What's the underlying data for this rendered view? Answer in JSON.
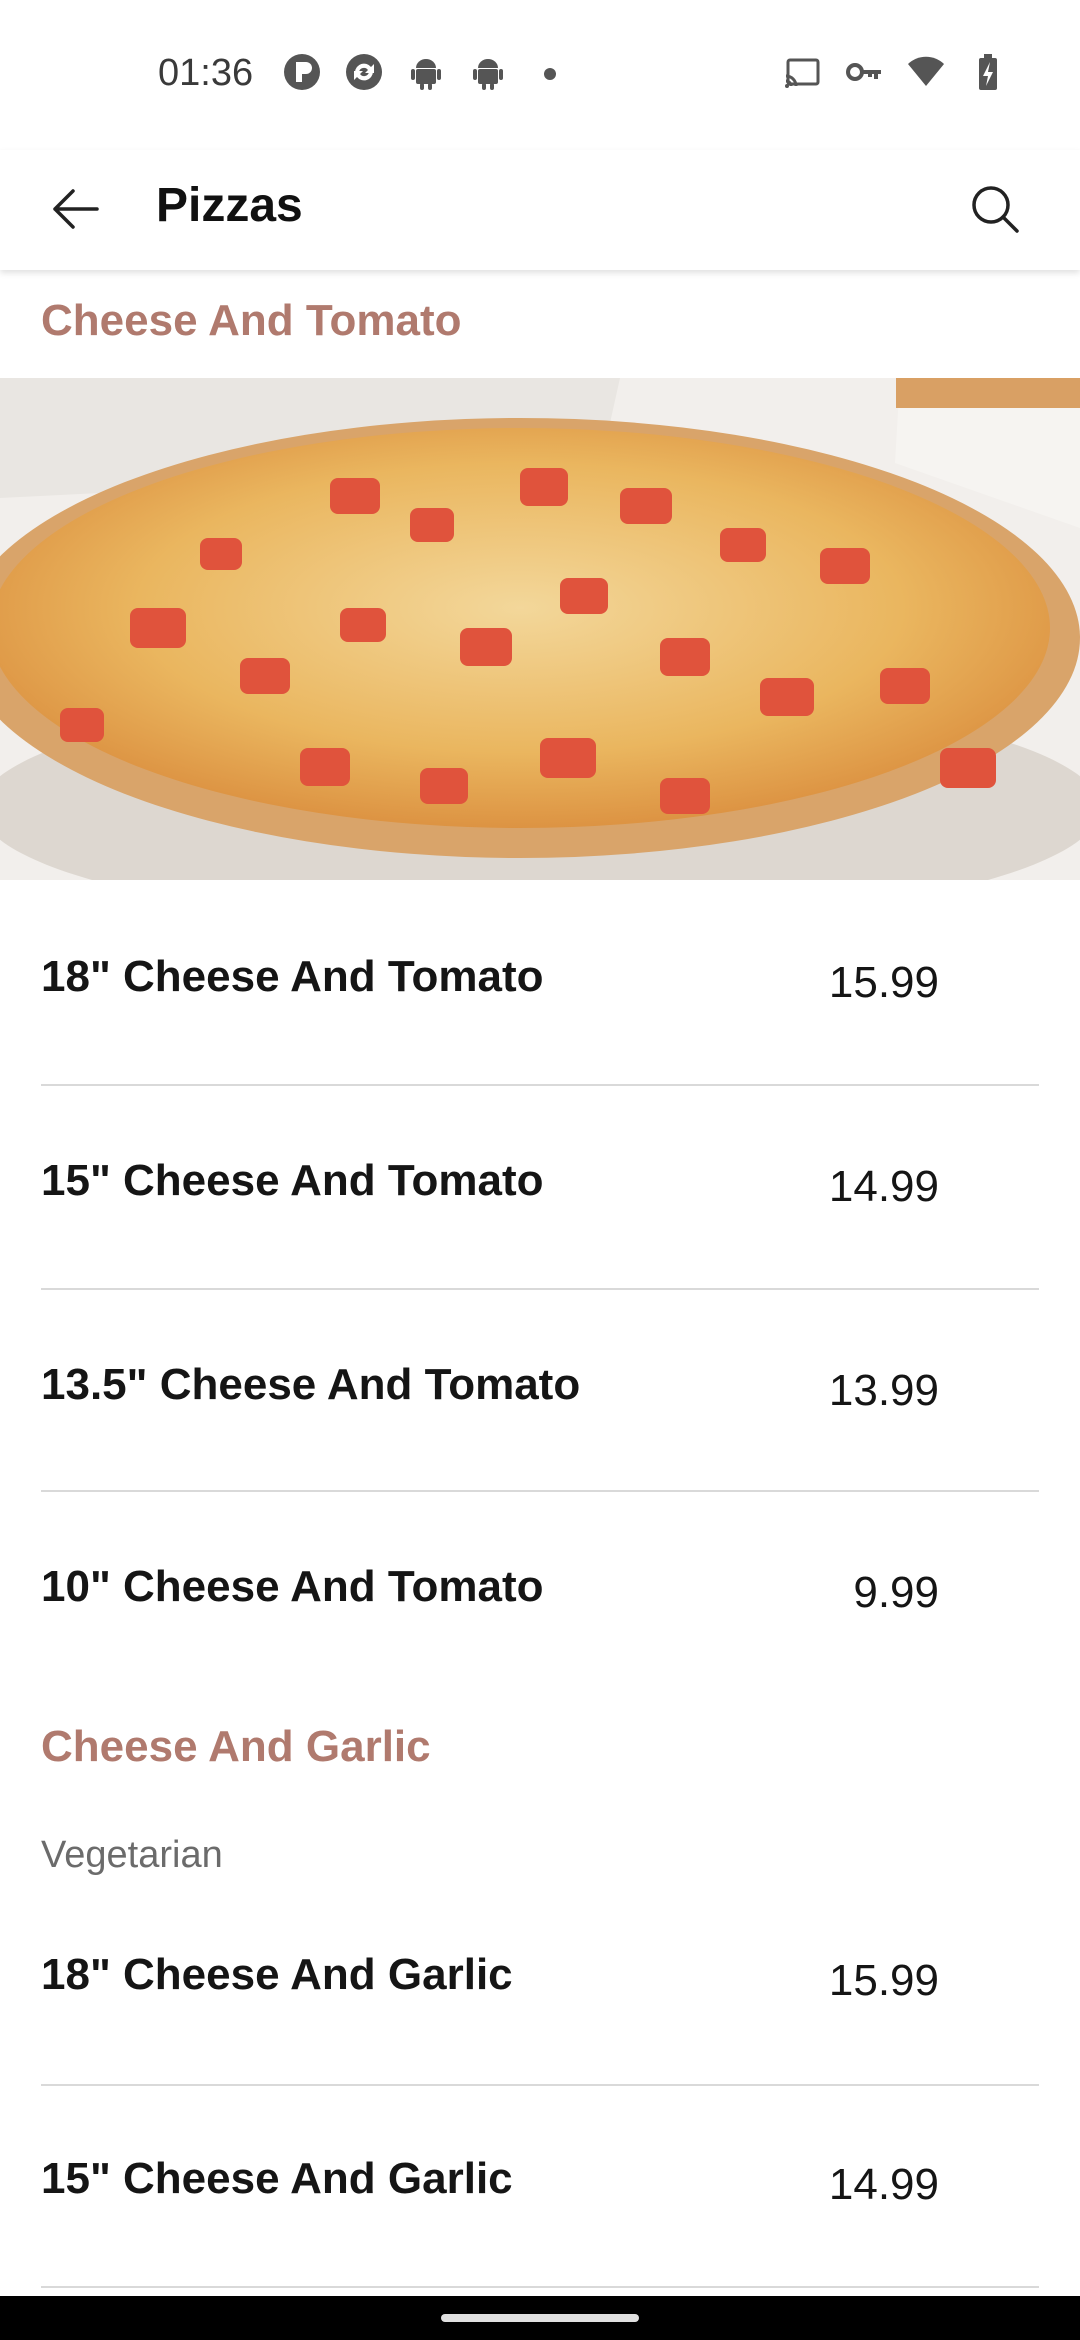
{
  "status": {
    "time": "01:36",
    "left_icons": [
      "app-notification-icon",
      "sync-icon",
      "android-icon",
      "android-icon",
      "dot-icon"
    ],
    "right_icons": [
      "cast-icon",
      "vpn-key-icon",
      "wifi-icon",
      "battery-charging-icon"
    ]
  },
  "appbar": {
    "title": "Pizzas",
    "back_icon": "arrow-left-icon",
    "search_icon": "search-icon"
  },
  "sections": [
    {
      "title": "Cheese And Tomato",
      "items": [
        {
          "name": "18\" Cheese And Tomato",
          "price": "15.99"
        },
        {
          "name": "15\" Cheese And Tomato",
          "price": "14.99"
        },
        {
          "name": "13.5\" Cheese And Tomato",
          "price": "13.99"
        },
        {
          "name": "10\" Cheese And Tomato",
          "price": "9.99"
        }
      ]
    },
    {
      "title": "Cheese And Garlic",
      "tag": "Vegetarian",
      "items": [
        {
          "name": "18\" Cheese And Garlic",
          "price": "15.99"
        },
        {
          "name": "15\" Cheese And Garlic",
          "price": "14.99"
        }
      ]
    }
  ],
  "colors": {
    "section_title": "#b07a6e",
    "text": "#151515",
    "divider": "#d9d9d9"
  }
}
